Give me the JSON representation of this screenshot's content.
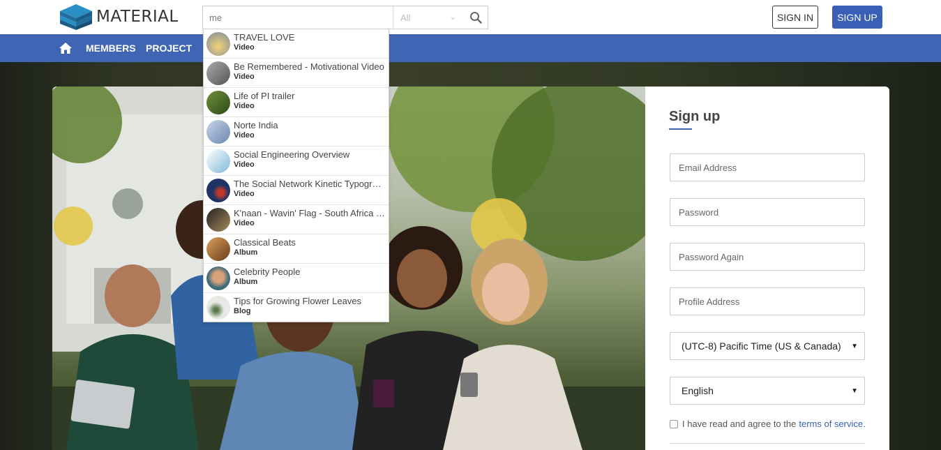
{
  "header": {
    "logo_text": "MATERIAL",
    "search": {
      "value": "me",
      "scope": "All"
    },
    "signin_label": "SIGN IN",
    "signup_label": "SIGN UP"
  },
  "nav": {
    "items": [
      {
        "label": "MEMBERS"
      },
      {
        "label": "PROJECT"
      }
    ]
  },
  "dropdown": {
    "items": [
      {
        "title": "TRAVEL LOVE",
        "type": "Video",
        "thumb": "#d9a25b"
      },
      {
        "title": "Be Remembered - Motivational Video",
        "type": "Video",
        "thumb": "#8a8a80"
      },
      {
        "title": "Life of PI trailer",
        "type": "Video",
        "thumb": "#4e6a2e"
      },
      {
        "title": "Norte India",
        "type": "Video",
        "thumb": "#8fa7c9"
      },
      {
        "title": "Social Engineering Overview",
        "type": "Video",
        "thumb": "#5fa3c8"
      },
      {
        "title": "The Social Network Kinetic Typography",
        "type": "Video",
        "thumb": "#2a3f7a"
      },
      {
        "title": "K'naan - Wavin' Flag - South Africa FIFA",
        "type": "Video",
        "thumb": "#6e5a3e"
      },
      {
        "title": "Classical Beats",
        "type": "Album",
        "thumb": "#8c5a2a"
      },
      {
        "title": "Celebrity People",
        "type": "Album",
        "thumb": "#3f6c7a"
      },
      {
        "title": "Tips for Growing Flower Leaves",
        "type": "Blog",
        "thumb": "#cfd6cc"
      }
    ]
  },
  "signup": {
    "title": "Sign up",
    "email_placeholder": "Email Address",
    "password_placeholder": "Password",
    "password_again_placeholder": "Password Again",
    "profile_placeholder": "Profile Address",
    "timezone": "(UTC-8) Pacific Time (US & Canada)",
    "language": "English",
    "terms_text": "I have read and agree to the",
    "terms_link": "terms of service."
  },
  "colors": {
    "brand": "#4065b4",
    "signup_button": "#3a5fb6"
  }
}
